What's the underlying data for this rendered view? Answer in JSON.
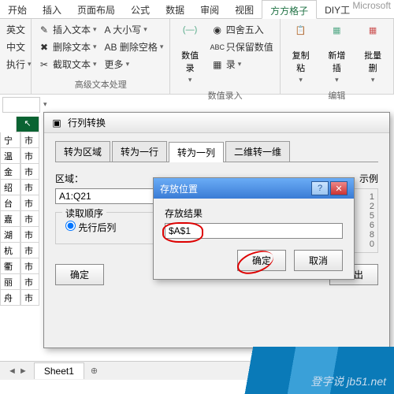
{
  "app_title": "Microsoft",
  "ribbon": {
    "tabs": [
      "开始",
      "插入",
      "页面布局",
      "公式",
      "数据",
      "审阅",
      "视图",
      "方方格子",
      "DIY工"
    ],
    "active": "方方格子",
    "group_text": {
      "items": [
        "插入文本",
        "删除文本",
        "截取文本"
      ],
      "col2": [
        "A 大小写",
        "AB 删除空格",
        "更多"
      ],
      "label": "高级文本处理"
    },
    "group_num": {
      "big": "数值录",
      "items": [
        "四舍五入",
        "只保留数值",
        "录"
      ],
      "label": "数值录入"
    },
    "group_edit": {
      "items": [
        "复制粘",
        "新增插",
        "批量删"
      ],
      "label": "编辑"
    }
  },
  "row_labels": [
    "宁",
    "温",
    "金",
    "绍",
    "台",
    "嘉",
    "湖",
    "杭",
    "衢",
    "丽",
    "舟"
  ],
  "col_b": [
    "市",
    "市",
    "市",
    "市",
    "市",
    "市",
    "市",
    "市",
    "市",
    "市",
    "市"
  ],
  "dlg1": {
    "title": "行列转换",
    "tabs": [
      "转为区域",
      "转为一行",
      "转为一列",
      "二维转一维"
    ],
    "active": "转为一列",
    "region_label": "区域：",
    "region_value": "A1:Q21",
    "order_label": "读取顺序",
    "radio1": "先行后列",
    "example_label": "示例",
    "ok": "确定",
    "exit": "退出"
  },
  "dlg2": {
    "title": "存放位置",
    "result_label": "存放结果",
    "result_value": "$A$1",
    "ok": "确定",
    "cancel": "取消"
  },
  "side_nums": [
    "1",
    "2",
    "5",
    "6",
    "8",
    "0"
  ],
  "sheets": {
    "nav": "◄ ►",
    "tab1": "Sheet1",
    "add": "⊕"
  },
  "watermark": "登字说 jb51.net"
}
